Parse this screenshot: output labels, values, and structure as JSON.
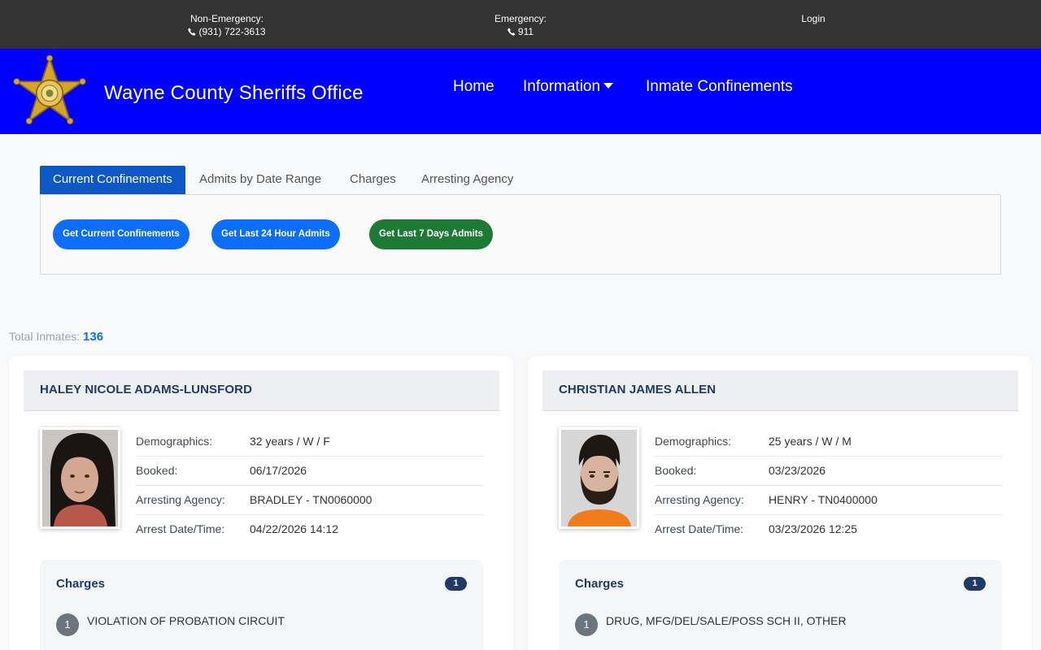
{
  "topbar": {
    "non_emergency_label": "Non-Emergency:",
    "non_emergency_phone": "(931) 722-3613",
    "emergency_label": "Emergency:",
    "emergency_phone": "911",
    "login": "Login"
  },
  "navbar": {
    "brand": "Wayne County Sheriffs Office",
    "items": [
      "Home",
      "Information",
      "Inmate Confinements"
    ]
  },
  "tabs": [
    {
      "label": "Current Confinements",
      "active": true
    },
    {
      "label": "Admits by Date Range",
      "active": false
    },
    {
      "label": "Charges",
      "active": false
    },
    {
      "label": "Arresting Agency",
      "active": false
    }
  ],
  "buttons": {
    "current": "Get Current Confinements",
    "last24": "Get Last 24 Hour Admits",
    "last7": "Get Last 7 Days Admits"
  },
  "total": {
    "label": "Total Inmates:",
    "count": "136"
  },
  "labels": {
    "demographics": "Demographics:",
    "booked": "Booked:",
    "agency": "Arresting Agency:",
    "arrest": "Arrest Date/Time:",
    "charges": "Charges"
  },
  "inmates": [
    {
      "name": "HALEY NICOLE ADAMS-LUNSFORD",
      "demographics": "32 years / W / F",
      "booked": "06/17/2026",
      "agency": "BRADLEY - TN0060000",
      "arrest": "04/22/2026 14:12",
      "charge_count": "1",
      "charges": [
        {
          "num": "1",
          "text": "VIOLATION OF PROBATION CIRCUIT"
        }
      ]
    },
    {
      "name": "CHRISTIAN JAMES ALLEN",
      "demographics": "25 years / W / M",
      "booked": "03/23/2026",
      "agency": "HENRY - TN0400000",
      "arrest": "03/23/2026 12:25",
      "charge_count": "1",
      "charges": [
        {
          "num": "1",
          "text": "DRUG, MFG/DEL/SALE/POSS SCH II, OTHER"
        }
      ]
    }
  ],
  "colors": {
    "navbar": "#0000ff",
    "topbar": "#333333",
    "active_tab": "#0d57c6",
    "primary": "#0d6efd",
    "success": "#1c7a34"
  }
}
